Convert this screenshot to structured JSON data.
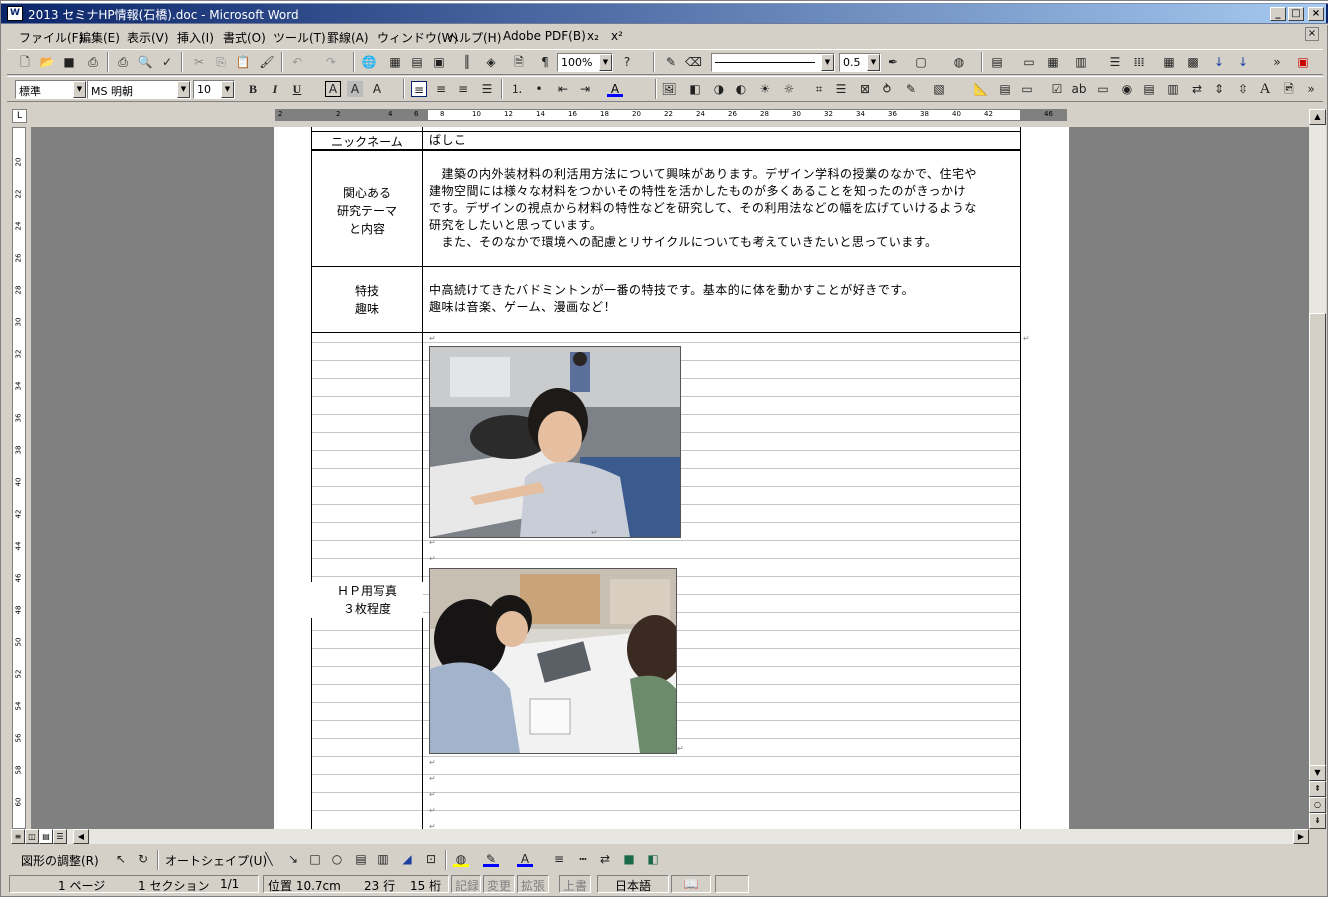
{
  "window": {
    "title": "2013 セミナHP情報(石橋).doc - Microsoft Word",
    "icon_label": "W"
  },
  "menu": [
    "ファイル(F)",
    "編集(E)",
    "表示(V)",
    "挿入(I)",
    "書式(O)",
    "ツール(T)",
    "罫線(A)",
    "ウィンドウ(W)",
    "ヘルプ(H)",
    "Adobe PDF(B)",
    "x₂",
    "x²"
  ],
  "toolbar": {
    "zoom": "100%",
    "line_width": "0.5",
    "style": "標準",
    "font": "MS 明朝",
    "font_size": "10",
    "bold": "B",
    "italic": "I",
    "underline": "U"
  },
  "ruler": {
    "labels": [
      "2",
      "2",
      "4",
      "6",
      "8",
      "10",
      "12",
      "14",
      "16",
      "18",
      "20",
      "22",
      "24",
      "26",
      "28",
      "30",
      "32",
      "34",
      "36",
      "38",
      "40",
      "42",
      "46"
    ]
  },
  "vruler": {
    "labels": [
      "20",
      "22",
      "24",
      "26",
      "28",
      "30",
      "32",
      "34",
      "36",
      "38",
      "40",
      "42",
      "44",
      "46",
      "48",
      "50",
      "52",
      "54",
      "56",
      "58",
      "60"
    ]
  },
  "document": {
    "rows": [
      {
        "label": "ニックネーム",
        "content": [
          "ばしこ"
        ]
      },
      {
        "label_lines": [
          "関心ある",
          "研究テーマ",
          "と内容"
        ],
        "content": [
          "　建築の内外装材料の利活用方法について興味があります。デザイン学科の授業のなかで、住宅や",
          "建物空間には様々な材料をつかいその特性を活かしたものが多くあることを知ったのがきっかけ",
          "です。デザインの視点から材料の特性などを研究して、その利用法などの幅を広げていけるような",
          "研究をしたいと思っています。",
          "　また、そのなかで環境への配慮とリサイクルについても考えていきたいと思っています。"
        ]
      },
      {
        "label_lines": [
          "特技",
          "趣味"
        ],
        "content": [
          "中高続けてきたバドミントンが一番の特技です。基本的に体を動かすことが好きです。",
          "趣味は音楽、ゲーム、漫画など！"
        ]
      },
      {
        "label_lines": [
          "ＨＰ用写真",
          "３枚程度"
        ]
      }
    ]
  },
  "drawing_toolbar": {
    "adjust": "図形の調整(R)",
    "autoshape": "オートシェイプ(U)"
  },
  "status": {
    "page": "1 ページ",
    "section": "1 セクション",
    "pages": "1/1",
    "position": "位置 10.7cm",
    "line": "23 行",
    "column": "15 桁",
    "rec": "記録",
    "trk": "変更",
    "ext": "拡張",
    "ovr": "上書",
    "language": "日本語"
  }
}
